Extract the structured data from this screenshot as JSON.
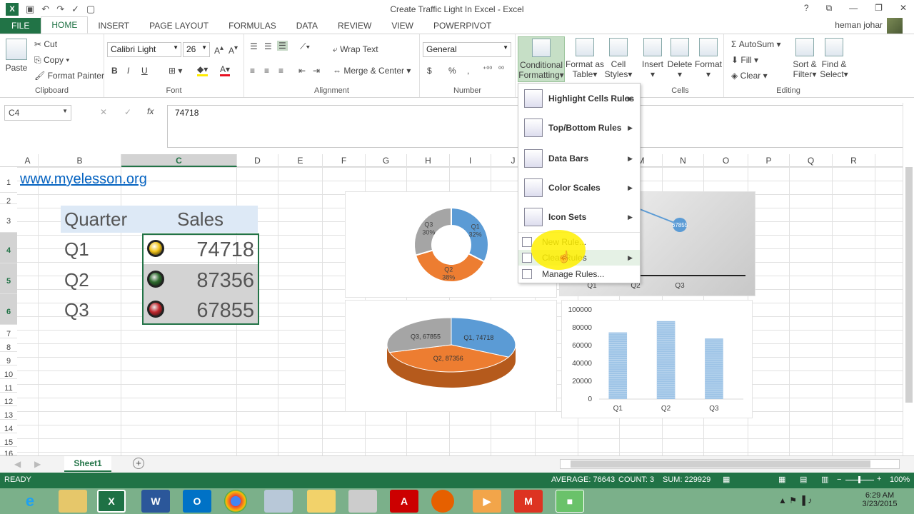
{
  "window": {
    "title": "Create Traffic Light In Excel - Excel",
    "controls": [
      "?",
      "⧉",
      "—",
      "❐",
      "✕"
    ]
  },
  "quick_access": {
    "icons": [
      "save-icon",
      "undo-icon",
      "redo-icon",
      "spelling-icon",
      "new-icon"
    ]
  },
  "tabs": [
    "FILE",
    "HOME",
    "INSERT",
    "PAGE LAYOUT",
    "FORMULAS",
    "DATA",
    "REVIEW",
    "VIEW",
    "POWERPIVOT"
  ],
  "active_tab": "HOME",
  "user": "heman johar",
  "ribbon": {
    "clipboard": {
      "paste": "Paste",
      "cut": "Cut",
      "copy": "Copy",
      "format_painter": "Format Painter",
      "label": "Clipboard"
    },
    "font": {
      "name": "Calibri Light",
      "size": "26",
      "bold": "B",
      "italic": "I",
      "underline": "U",
      "label": "Font"
    },
    "alignment": {
      "wrap": "Wrap Text",
      "merge": "Merge & Center",
      "label": "Alignment"
    },
    "number": {
      "format": "General",
      "currency": "$",
      "percent": "%",
      "comma": ",",
      "label": "Number"
    },
    "styles": {
      "conditional": "Conditional",
      "conditional2": "Formatting",
      "format_table": "Format as",
      "format_table2": "Table",
      "cell_styles": "Cell",
      "cell_styles2": "Styles"
    },
    "cells": {
      "insert": "Insert",
      "delete": "Delete",
      "format": "Format",
      "label": "Cells"
    },
    "editing": {
      "autosum": "AutoSum",
      "fill": "Fill",
      "clear": "Clear",
      "sort": "Sort &",
      "sort2": "Filter",
      "find": "Find &",
      "find2": "Select",
      "label": "Editing"
    }
  },
  "formula_bar": {
    "name_box": "C4",
    "value": "74718"
  },
  "columns": [
    "A",
    "B",
    "C",
    "D",
    "E",
    "F",
    "G",
    "H",
    "I",
    "J",
    "K",
    "L",
    "M",
    "N",
    "O",
    "P",
    "Q",
    "R"
  ],
  "rows": [
    "1",
    "2",
    "3",
    "4",
    "5",
    "6",
    "7",
    "8",
    "9",
    "10",
    "11",
    "12",
    "13",
    "14",
    "15",
    "16"
  ],
  "cells": {
    "a1": "www.myelesson.org",
    "b3": "Quarter",
    "c3": "Sales",
    "data": [
      {
        "quarter": "Q1",
        "sales": "74718",
        "light": "#f2c318"
      },
      {
        "quarter": "Q2",
        "sales": "87356",
        "light": "#2d6a2d"
      },
      {
        "quarter": "Q3",
        "sales": "67855",
        "light": "#c0262c"
      }
    ]
  },
  "menu": {
    "items": [
      {
        "label": "Highlight Cells Rules",
        "icon": "highlight-cells-icon"
      },
      {
        "label": "Top/Bottom Rules",
        "icon": "top-bottom-icon"
      },
      {
        "label": "Data Bars",
        "icon": "data-bars-icon"
      },
      {
        "label": "Color Scales",
        "icon": "color-scales-icon"
      },
      {
        "label": "Icon Sets",
        "icon": "icon-sets-icon"
      }
    ],
    "small": [
      {
        "label": "New Rule...",
        "icon": "new-rule-icon"
      },
      {
        "label": "Clear Rules",
        "icon": "clear-rules-icon"
      },
      {
        "label": "Manage Rules...",
        "icon": "manage-rules-icon"
      }
    ]
  },
  "chart_data": [
    {
      "type": "pie",
      "subtype": "doughnut",
      "labels": [
        "Q1",
        "Q2",
        "Q3"
      ],
      "values": [
        74718,
        87356,
        67855
      ],
      "percent_labels": [
        "32%",
        "38%",
        "30%"
      ],
      "colors": [
        "#5b9bd5",
        "#ed7d31",
        "#a5a5a5"
      ]
    },
    {
      "type": "pie",
      "subtype": "3d",
      "data_labels": [
        "Q1, 74718",
        "Q2, 87356",
        "Q3, 67855"
      ],
      "values": [
        74718,
        87356,
        67855
      ],
      "colors": [
        "#5b9bd5",
        "#ed7d31",
        "#a5a5a5"
      ]
    },
    {
      "type": "bar",
      "categories": [
        "Q1",
        "Q2",
        "Q3"
      ],
      "values": [
        74718,
        87356,
        67855
      ],
      "yticks": [
        "100000",
        "80000",
        "60000",
        "40000",
        "20000",
        "0"
      ],
      "ylim": [
        0,
        100000
      ],
      "color": "#9dc3e6"
    },
    {
      "type": "line",
      "categories": [
        "Q1",
        "Q2",
        "Q3"
      ],
      "point_label": "67855"
    }
  ],
  "sheet": {
    "name": "Sheet1"
  },
  "status": {
    "ready": "READY",
    "average": "AVERAGE: 76643",
    "count": "COUNT: 3",
    "sum": "SUM: 229929",
    "zoom": "100%"
  },
  "clock": {
    "time": "6:29 AM",
    "date": "3/23/2015"
  }
}
